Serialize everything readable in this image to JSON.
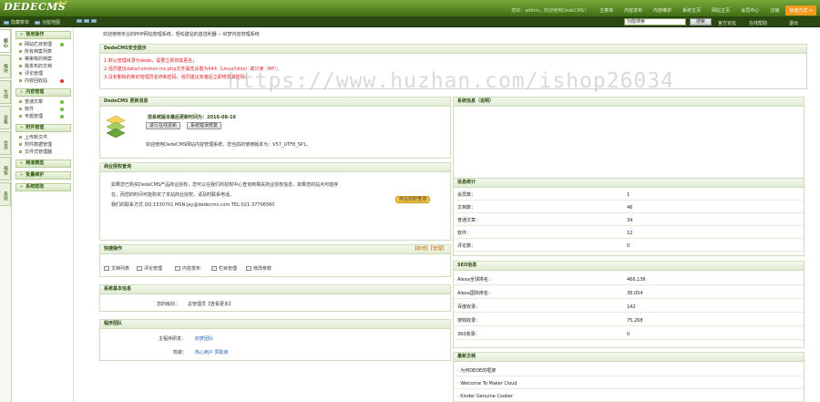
{
  "header": {
    "logo": "DEDECMS",
    "logo_version": "v5.7",
    "user_info": "您好：admin，欢迎使用DedeCMS！",
    "nav": [
      "主菜单",
      "内容发布",
      "内容维护",
      "系统主页",
      "网站主页",
      "会员中心",
      "注销"
    ],
    "active_nav": "快速方式 +"
  },
  "toolbar": {
    "item1": "隐藏菜单",
    "item2": "功能地图",
    "search_placeholder": "功能搜索",
    "search_button": "搜索",
    "link1": "官方论坛",
    "link2": "在线帮助",
    "link3": "退出"
  },
  "vtabs": [
    "核心",
    "模块",
    "生成",
    "采集",
    "会员",
    "模板",
    "系统"
  ],
  "sidebar": {
    "sections": [
      {
        "title": "常用操作",
        "items": [
          "网站栏目管理",
          "所有档案列表",
          "等审核的档案",
          "我发布的文档",
          "评论管理",
          "内容回收站"
        ]
      },
      {
        "title": "内容管理",
        "items": [
          "普通文章",
          "软件",
          "专题管理"
        ]
      },
      {
        "title": "附件管理",
        "items": [
          "上传新文件",
          "附件数据管理",
          "文件式管理器"
        ]
      },
      {
        "title": "频道模型",
        "items": []
      },
      {
        "title": "批量维护",
        "items": []
      },
      {
        "title": "系统帮助",
        "items": []
      }
    ]
  },
  "breadcrumb": "欢迎使用专业的PHP网站管理系统，轻松建站的首选利器 -- 织梦内容管理系统",
  "security": {
    "title": "DedeCMS安全提示",
    "lines": [
      "1.默认管理目录为dede，需要立即将其更名；",
      "2.强烈建议data/common.inc.php文件属性设置为644（Linux/Unix）或只读（NT）；",
      "3.没有删除的新的管理员名称和密码，强烈建议安装后立即修改其密码；"
    ]
  },
  "update": {
    "title": "DedeCMS 更新消息",
    "last": "您系统版本最后更新时间为：2016-08-16",
    "btn1": "进行在线更新",
    "btn2": "系统错误修复",
    "version": "欢迎使用DedeCMS网站内容管理系统，您当前的使用版本为：V57_UTF8_SP1。"
  },
  "info_panel": {
    "title": "系统信息（说明）"
  },
  "license": {
    "title": "商业授权查询",
    "text1": "如果您已购买DedeCMS产品商业授权，您可以在我们的授权中心查询到相关商业授权信息，如果您的站点可能存",
    "text2": "在，而您的时间可能购买了本站商业授权，请及时联系电话。",
    "text3": "我们的联系方式  QQ:1530701 MSN:jay@dedecms.com TEL:021-37706560",
    "btn": "商业授权查询"
  },
  "stats": {
    "title": "信息统计",
    "rows": [
      [
        "会员数：",
        "1"
      ],
      [
        "文档数：",
        "46"
      ],
      [
        "普通文章：",
        "34"
      ],
      [
        "软件：",
        "12"
      ],
      [
        "评论数：",
        "0"
      ]
    ]
  },
  "seo": {
    "title": "SEO信息",
    "rows": [
      [
        "Alexa全球排名：",
        "466,136"
      ],
      [
        "Alexa国际排名：",
        "38,054"
      ],
      [
        "百度收录：",
        "142"
      ],
      [
        "搜狗收录：",
        "75,268"
      ],
      [
        "360收录：",
        "0"
      ]
    ]
  },
  "quick": {
    "title": "快捷操作",
    "actions": "【新增】【管理】",
    "items": [
      "文档列表",
      "评论管理",
      "内容发布",
      "栏目管理",
      "修改参数"
    ]
  },
  "sysinfo": {
    "title": "系统基本信息",
    "label": "您的级别：",
    "value": "总管理员【查看更多】"
  },
  "team": {
    "title": "程序团队",
    "l1": "主程序研发：",
    "v1": "织梦团队",
    "l2": "鸣谢：",
    "v2": "热心用户  赞助商"
  },
  "latest": {
    "title": "最新文档",
    "items": [
      "为何DEDE的框架",
      "Welcome To Maker Cloud",
      "Kinder Genuine Cooker"
    ]
  },
  "watermark": "https://www.huzhan.com/ishop26034"
}
